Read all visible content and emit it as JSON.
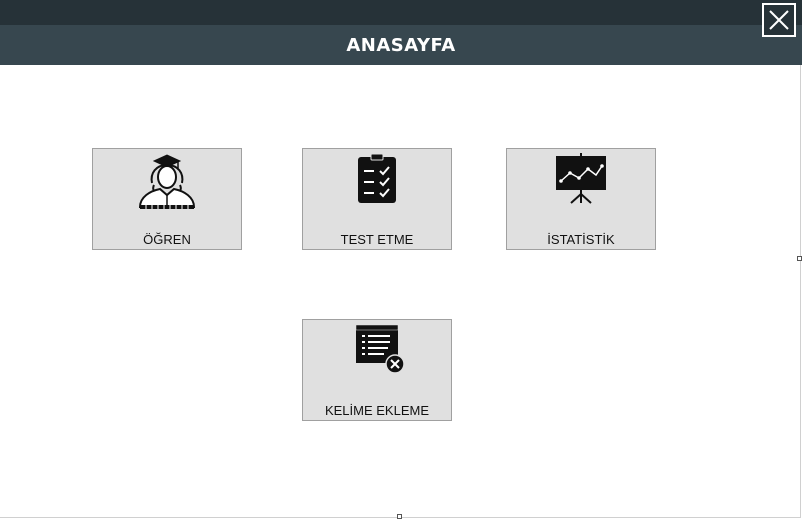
{
  "window": {
    "title": "ANASAYFA",
    "close_icon": "close-icon"
  },
  "tiles": [
    {
      "label": "ÖĞREN",
      "icon": "student-graduate-icon"
    },
    {
      "label": "TEST ETME",
      "icon": "clipboard-checklist-icon"
    },
    {
      "label": "İSTATİSTİK",
      "icon": "presentation-chart-icon"
    },
    {
      "label": "KELİME EKLEME",
      "icon": "word-list-add-icon"
    }
  ],
  "colors": {
    "titlebar_top": "#263238",
    "header": "#37474f",
    "tile_background": "#e0e0e0",
    "tile_border": "#a0a0a0"
  }
}
